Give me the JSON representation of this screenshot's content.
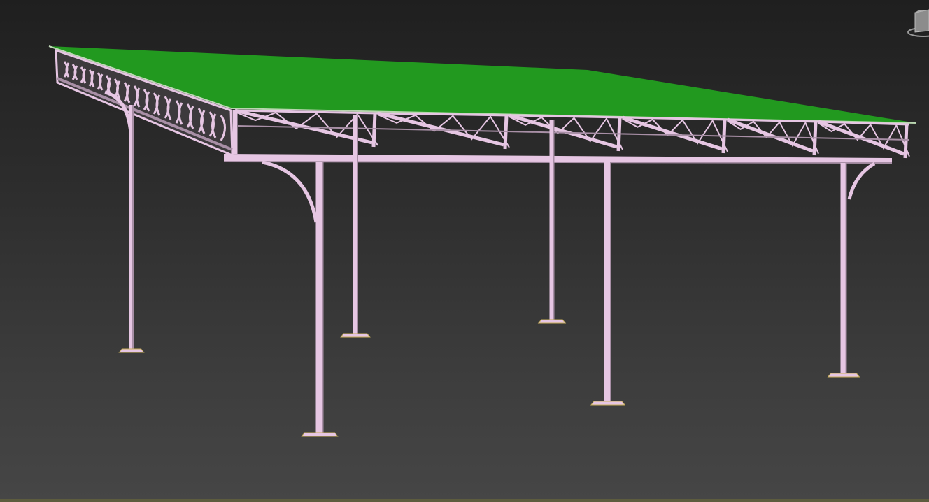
{
  "viewport": {
    "background_top": "#1f1f1f",
    "background_bottom": "#464646",
    "bottom_strip_color": "#5d5c3e"
  },
  "model": {
    "roof_color": "#22991f",
    "roof_edge_color": "#b9d6b0",
    "steel_color": "#e6c6e3",
    "steel_shadow": "#a88fa6",
    "baseplate_color": "#c9b05a"
  },
  "viewcube": {
    "icon": "viewcube-icon",
    "color": "#9a9a9a"
  }
}
